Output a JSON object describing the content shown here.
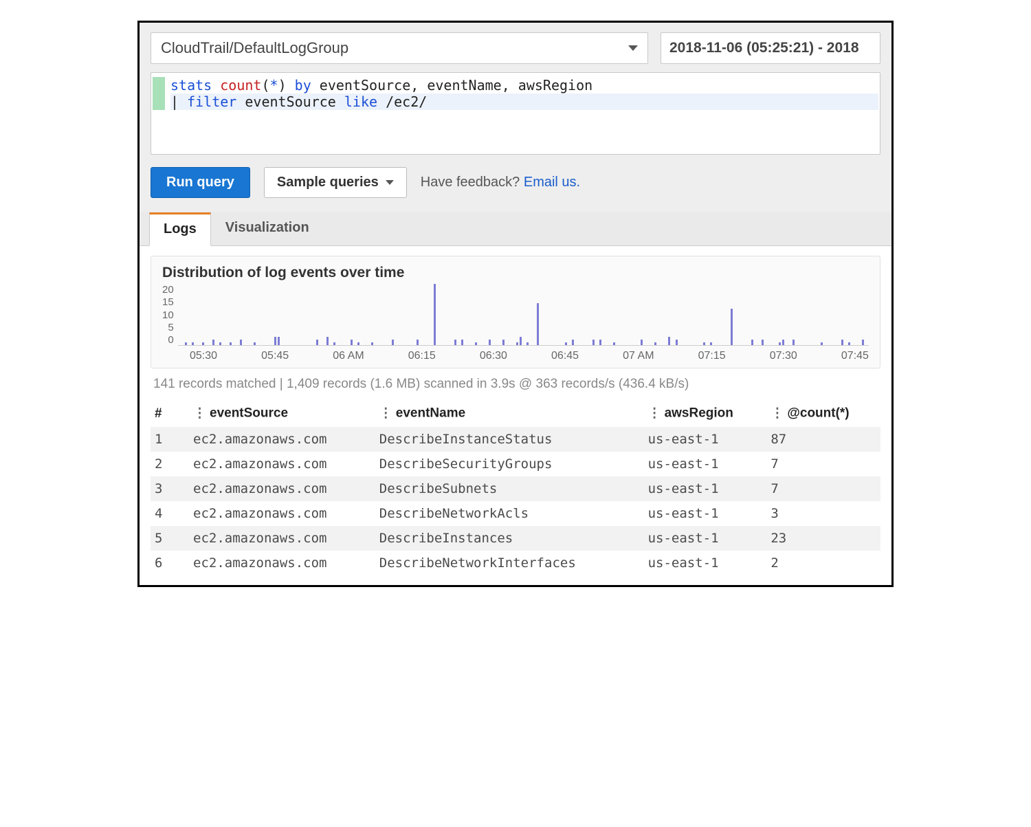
{
  "controls": {
    "logGroup": "CloudTrail/DefaultLogGroup",
    "dateRange": "2018-11-06 (05:25:21) - 2018",
    "runQuery": "Run query",
    "sampleQueries": "Sample queries",
    "feedbackPrompt": "Have feedback? ",
    "feedbackLink": "Email us."
  },
  "query_tokens": [
    [
      {
        "t": "stats",
        "c": "kw-blue"
      },
      {
        "t": " ",
        "c": ""
      },
      {
        "t": "count",
        "c": "kw-red"
      },
      {
        "t": "(",
        "c": "kw-black"
      },
      {
        "t": "*",
        "c": "kw-blue"
      },
      {
        "t": ") ",
        "c": "kw-black"
      },
      {
        "t": "by",
        "c": "kw-blue"
      },
      {
        "t": " eventSource, eventName, awsRegion",
        "c": "kw-black"
      }
    ],
    [
      {
        "t": "| ",
        "c": "kw-black"
      },
      {
        "t": "filter",
        "c": "kw-blue"
      },
      {
        "t": " eventSource ",
        "c": "kw-black"
      },
      {
        "t": "like",
        "c": "kw-blue"
      },
      {
        "t": " /ec2/",
        "c": "kw-black"
      }
    ]
  ],
  "tabs": {
    "logs": "Logs",
    "visualization": "Visualization"
  },
  "chart_data": {
    "type": "bar",
    "title": "Distribution of log events over time",
    "ylabel": "",
    "ylim": [
      0,
      22
    ],
    "yticks": [
      20,
      15,
      10,
      5,
      0
    ],
    "xticks": [
      "05:30",
      "05:45",
      "06 AM",
      "06:15",
      "06:30",
      "06:45",
      "07 AM",
      "07:15",
      "07:30",
      "07:45"
    ],
    "series": [
      {
        "name": "events",
        "values": [
          {
            "x": 0.01,
            "y": 1
          },
          {
            "x": 0.02,
            "y": 1
          },
          {
            "x": 0.035,
            "y": 1
          },
          {
            "x": 0.05,
            "y": 2
          },
          {
            "x": 0.06,
            "y": 1
          },
          {
            "x": 0.075,
            "y": 1
          },
          {
            "x": 0.09,
            "y": 2
          },
          {
            "x": 0.11,
            "y": 1
          },
          {
            "x": 0.14,
            "y": 3
          },
          {
            "x": 0.145,
            "y": 3
          },
          {
            "x": 0.2,
            "y": 2
          },
          {
            "x": 0.215,
            "y": 3
          },
          {
            "x": 0.225,
            "y": 1
          },
          {
            "x": 0.25,
            "y": 2
          },
          {
            "x": 0.26,
            "y": 1
          },
          {
            "x": 0.28,
            "y": 1
          },
          {
            "x": 0.31,
            "y": 2
          },
          {
            "x": 0.345,
            "y": 2
          },
          {
            "x": 0.37,
            "y": 22
          },
          {
            "x": 0.4,
            "y": 2
          },
          {
            "x": 0.41,
            "y": 2
          },
          {
            "x": 0.43,
            "y": 1
          },
          {
            "x": 0.45,
            "y": 2
          },
          {
            "x": 0.47,
            "y": 2
          },
          {
            "x": 0.49,
            "y": 1
          },
          {
            "x": 0.495,
            "y": 3
          },
          {
            "x": 0.505,
            "y": 1
          },
          {
            "x": 0.52,
            "y": 15
          },
          {
            "x": 0.56,
            "y": 1
          },
          {
            "x": 0.57,
            "y": 2
          },
          {
            "x": 0.6,
            "y": 2
          },
          {
            "x": 0.61,
            "y": 2
          },
          {
            "x": 0.63,
            "y": 1
          },
          {
            "x": 0.67,
            "y": 2
          },
          {
            "x": 0.69,
            "y": 1
          },
          {
            "x": 0.71,
            "y": 3
          },
          {
            "x": 0.72,
            "y": 2
          },
          {
            "x": 0.76,
            "y": 1
          },
          {
            "x": 0.77,
            "y": 1
          },
          {
            "x": 0.8,
            "y": 13
          },
          {
            "x": 0.83,
            "y": 2
          },
          {
            "x": 0.845,
            "y": 2
          },
          {
            "x": 0.87,
            "y": 1
          },
          {
            "x": 0.875,
            "y": 2
          },
          {
            "x": 0.89,
            "y": 2
          },
          {
            "x": 0.93,
            "y": 1
          },
          {
            "x": 0.96,
            "y": 2
          },
          {
            "x": 0.97,
            "y": 1
          },
          {
            "x": 0.99,
            "y": 2
          }
        ]
      }
    ]
  },
  "scanSummary": "141 records matched | 1,409 records (1.6 MB) scanned in 3.9s @ 363 records/s (436.4 kB/s)",
  "columns": [
    "#",
    "eventSource",
    "eventName",
    "awsRegion",
    "@count(*)"
  ],
  "rows": [
    {
      "n": 1,
      "eventSource": "ec2.amazonaws.com",
      "eventName": "DescribeInstanceStatus",
      "awsRegion": "us-east-1",
      "count": 87
    },
    {
      "n": 2,
      "eventSource": "ec2.amazonaws.com",
      "eventName": "DescribeSecurityGroups",
      "awsRegion": "us-east-1",
      "count": 7
    },
    {
      "n": 3,
      "eventSource": "ec2.amazonaws.com",
      "eventName": "DescribeSubnets",
      "awsRegion": "us-east-1",
      "count": 7
    },
    {
      "n": 4,
      "eventSource": "ec2.amazonaws.com",
      "eventName": "DescribeNetworkAcls",
      "awsRegion": "us-east-1",
      "count": 3
    },
    {
      "n": 5,
      "eventSource": "ec2.amazonaws.com",
      "eventName": "DescribeInstances",
      "awsRegion": "us-east-1",
      "count": 23
    },
    {
      "n": 6,
      "eventSource": "ec2.amazonaws.com",
      "eventName": "DescribeNetworkInterfaces",
      "awsRegion": "us-east-1",
      "count": 2
    }
  ]
}
